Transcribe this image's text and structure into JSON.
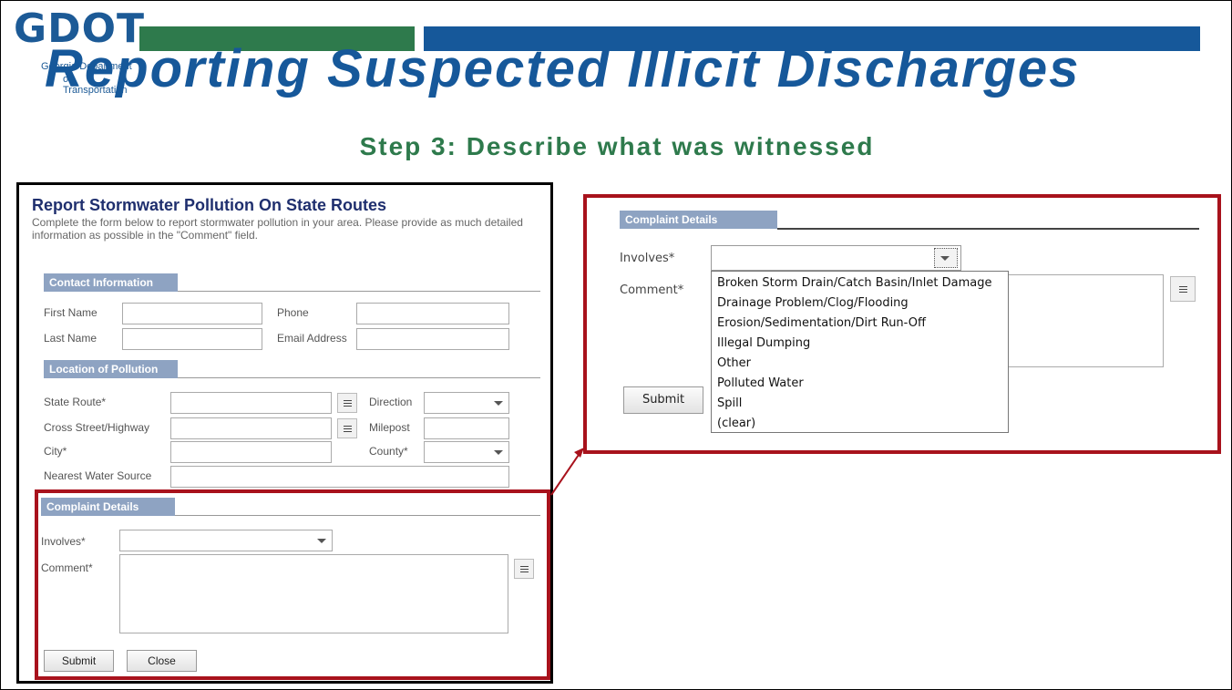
{
  "header": {
    "logo_text": "GDOT",
    "logo_sub_line1": "Georgia Department",
    "logo_sub_line2": "of Transportation",
    "title": "Reporting Suspected Illicit  Discharges",
    "subtitle": "Step 3: Describe what was witnessed"
  },
  "form": {
    "title": "Report Stormwater Pollution On State Routes",
    "description": "Complete the form below to report stormwater pollution in your area. Please provide as much detailed information as possible in the \"Comment\" field.",
    "contact_section": "Contact Information",
    "first_name_label": "First Name",
    "phone_label": "Phone",
    "last_name_label": "Last Name",
    "email_label": "Email Address",
    "location_section": "Location of Pollution",
    "state_route_label": "State Route*",
    "direction_label": "Direction",
    "cross_street_label": "Cross Street/Highway",
    "milepost_label": "Milepost",
    "city_label": "City*",
    "county_label": "County*",
    "nearest_water_label": "Nearest Water Source",
    "complaint_section": "Complaint Details",
    "involves_label": "Involves*",
    "comment_label": "Comment*",
    "submit_label": "Submit",
    "close_label": "Close"
  },
  "zoom": {
    "complaint_section": "Complaint Details",
    "involves_label": "Involves*",
    "comment_label": "Comment*",
    "submit_label": "Submit",
    "options": [
      "Broken Storm Drain/Catch Basin/Inlet Damage",
      "Drainage Problem/Clog/Flooding",
      "Erosion/Sedimentation/Dirt Run-Off",
      "Illegal Dumping",
      "Other",
      "Polluted Water",
      "Spill",
      "(clear)"
    ]
  },
  "colors": {
    "brand_blue": "#16589a",
    "brand_green": "#2e7a4c",
    "highlight_red": "#a8121c",
    "section_header": "#8ea3c2"
  }
}
